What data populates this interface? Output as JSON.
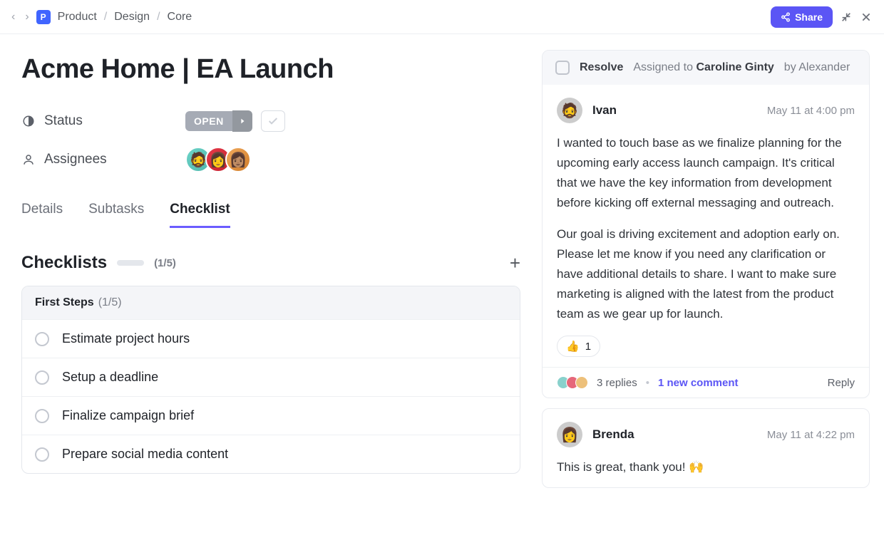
{
  "breadcrumb": {
    "badge": "P",
    "items": [
      "Product",
      "Design",
      "Core"
    ]
  },
  "share_label": "Share",
  "title": "Acme Home | EA Launch",
  "meta": {
    "status_label": "Status",
    "status_value": "OPEN",
    "assignees_label": "Assignees"
  },
  "tabs": [
    "Details",
    "Subtasks",
    "Checklist"
  ],
  "active_tab": 2,
  "checklists": {
    "title": "Checklists",
    "count": "(1/5)",
    "list_name": "First Steps",
    "list_count": "(1/5)",
    "items": [
      "Estimate project hours",
      "Setup a deadline",
      "Finalize campaign brief",
      "Prepare social media content"
    ]
  },
  "thread": {
    "resolve": "Resolve",
    "assigned_prefix": "Assigned to",
    "assigned_name": "Caroline Ginty",
    "assigned_by": "by Alexander",
    "comment1": {
      "author": "Ivan",
      "time": "May 11 at 4:00 pm",
      "p1": "I wanted to touch base as we finalize planning for the upcoming early access launch campaign. It's critical that we have the key information from development before kicking off external messaging and outreach.",
      "p2": "Our goal is driving excitement and adoption early on. Please let me know if you need any clarification or have additional details to share. I want to make sure marketing is aligned with the latest from the product team as we gear up for launch.",
      "reaction_emoji": "👍",
      "reaction_count": "1"
    },
    "footer": {
      "replies": "3 replies",
      "new": "1 new comment",
      "reply": "Reply"
    },
    "comment2": {
      "author": "Brenda",
      "time": "May 11 at 4:22 pm",
      "body": "This is great, thank you! 🙌"
    }
  }
}
